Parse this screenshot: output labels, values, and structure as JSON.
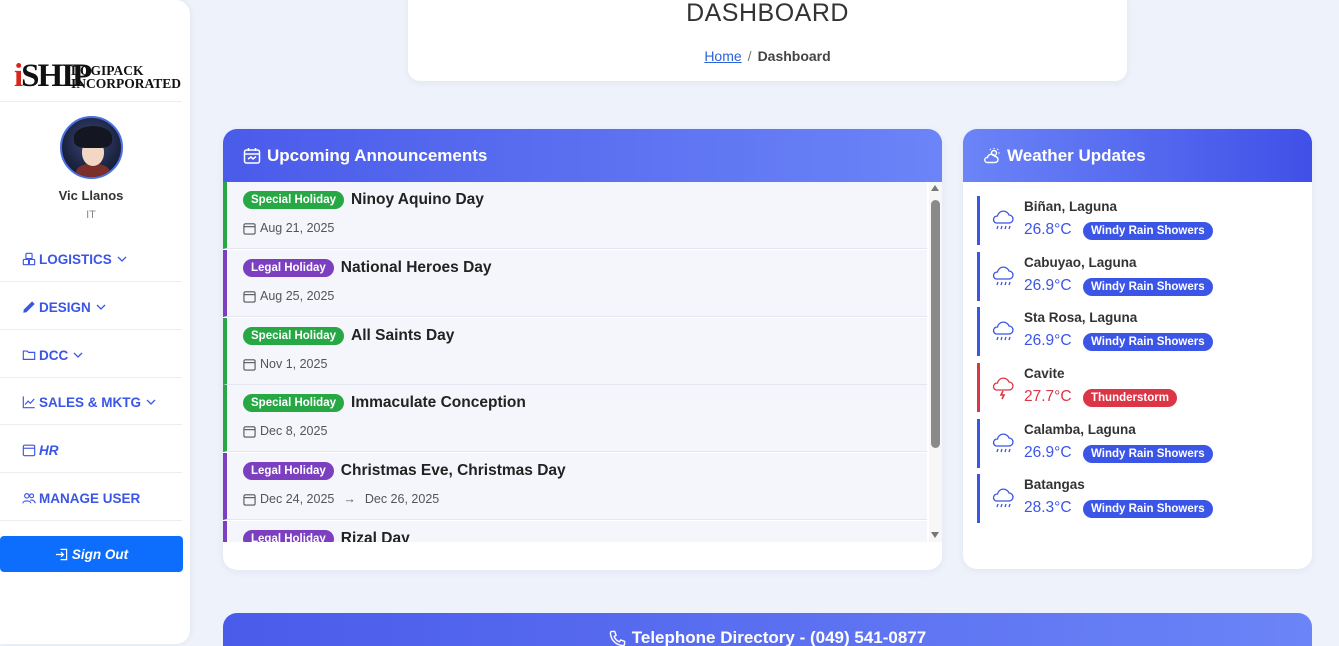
{
  "sidebar": {
    "logo": {
      "main": "iSHIP",
      "line1": "LOGIPACK",
      "line2": "INCORPORATED"
    },
    "user": {
      "name": "Vic Llanos",
      "dept": "IT"
    },
    "nav": [
      {
        "label": "LOGISTICS",
        "icon": "boxes-icon",
        "has_dropdown": true
      },
      {
        "label": "DESIGN",
        "icon": "pencil-icon",
        "has_dropdown": true
      },
      {
        "label": "DCC",
        "icon": "folder-icon",
        "has_dropdown": true
      },
      {
        "label": "SALES & MKTG",
        "icon": "chart-line-icon",
        "has_dropdown": true
      },
      {
        "label": "HR",
        "icon": "calendar-icon",
        "has_dropdown": false
      },
      {
        "label": "MANAGE USER",
        "icon": "users-icon",
        "has_dropdown": false
      }
    ],
    "signout_label": "Sign Out"
  },
  "header": {
    "title": "DASHBOARD",
    "breadcrumb_home": "Home",
    "breadcrumb_sep": "/",
    "breadcrumb_current": "Dashboard"
  },
  "announcements": {
    "title": "Upcoming Announcements",
    "items": [
      {
        "type": "Special Holiday",
        "title": "Ninoy Aquino Day",
        "date": "Aug 21, 2025",
        "end_date": ""
      },
      {
        "type": "Legal Holiday",
        "title": "National Heroes Day",
        "date": "Aug 25, 2025",
        "end_date": ""
      },
      {
        "type": "Special Holiday",
        "title": "All Saints Day",
        "date": "Nov 1, 2025",
        "end_date": ""
      },
      {
        "type": "Special Holiday",
        "title": "Immaculate Conception",
        "date": "Dec 8, 2025",
        "end_date": ""
      },
      {
        "type": "Legal Holiday",
        "title": "Christmas Eve, Christmas Day",
        "date": "Dec 24, 2025",
        "end_date": "Dec 26, 2025"
      },
      {
        "type": "Legal Holiday",
        "title": "Rizal Day",
        "date": "",
        "end_date": ""
      }
    ],
    "range_arrow": "→"
  },
  "weather": {
    "title": "Weather Updates",
    "items": [
      {
        "city": "Biñan, Laguna",
        "temp": "26.8°C",
        "condition": "Windy Rain Showers",
        "icon": "cloud-rain-icon"
      },
      {
        "city": "Cabuyao, Laguna",
        "temp": "26.9°C",
        "condition": "Windy Rain Showers",
        "icon": "cloud-rain-icon"
      },
      {
        "city": "Sta Rosa, Laguna",
        "temp": "26.9°C",
        "condition": "Windy Rain Showers",
        "icon": "cloud-rain-icon"
      },
      {
        "city": "Cavite",
        "temp": "27.7°C",
        "condition": "Thunderstorm",
        "icon": "cloud-lightning-icon"
      },
      {
        "city": "Calamba, Laguna",
        "temp": "26.9°C",
        "condition": "Windy Rain Showers",
        "icon": "cloud-rain-icon"
      },
      {
        "city": "Batangas",
        "temp": "28.3°C",
        "condition": "Windy Rain Showers",
        "icon": "cloud-rain-icon"
      }
    ]
  },
  "telephone": {
    "title": "Telephone Directory - (049) 541-0877"
  },
  "colors": {
    "accent": "#3b55e6",
    "special": "#28a745",
    "legal": "#7b3fbf",
    "storm": "#dc3545",
    "signout": "#0d6efd"
  }
}
